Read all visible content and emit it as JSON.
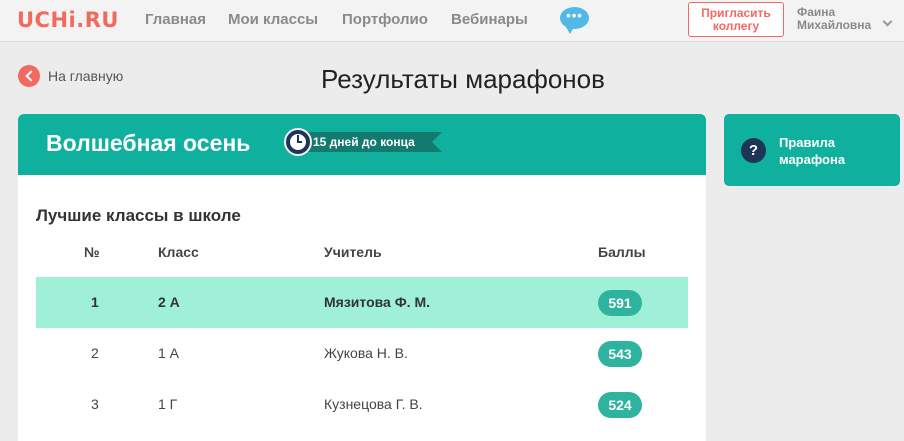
{
  "header": {
    "logo": "UCHi.RU",
    "nav": [
      "Главная",
      "Мои классы",
      "Портфолио",
      "Вебинары"
    ],
    "chat_icon": "chat-bubble-icon",
    "invite_label": "Пригласить коллегу",
    "user_name": "Фаина Михайловна"
  },
  "back_label": "На главную",
  "page_title": "Результаты марафонов",
  "marathon": {
    "title": "Волшебная осень",
    "days_left": "15 дней до конца"
  },
  "rules_label": "Правила марафона",
  "table": {
    "title": "Лучшие классы в школе",
    "headers": [
      "№",
      "Класс",
      "Учитель",
      "Баллы"
    ],
    "rows": [
      {
        "num": "1",
        "class": "2 А",
        "teacher": "Мязитова Ф. М.",
        "score": "591"
      },
      {
        "num": "2",
        "class": "1 А",
        "teacher": "Жукова Н. В.",
        "score": "543"
      },
      {
        "num": "3",
        "class": "1 Г",
        "teacher": "Кузнецова Г. В.",
        "score": "524"
      }
    ]
  },
  "colors": {
    "brand": "#f2695f",
    "teal": "#10b09f",
    "highlight_row": "#9ff0d6",
    "navy": "#1d3557"
  }
}
